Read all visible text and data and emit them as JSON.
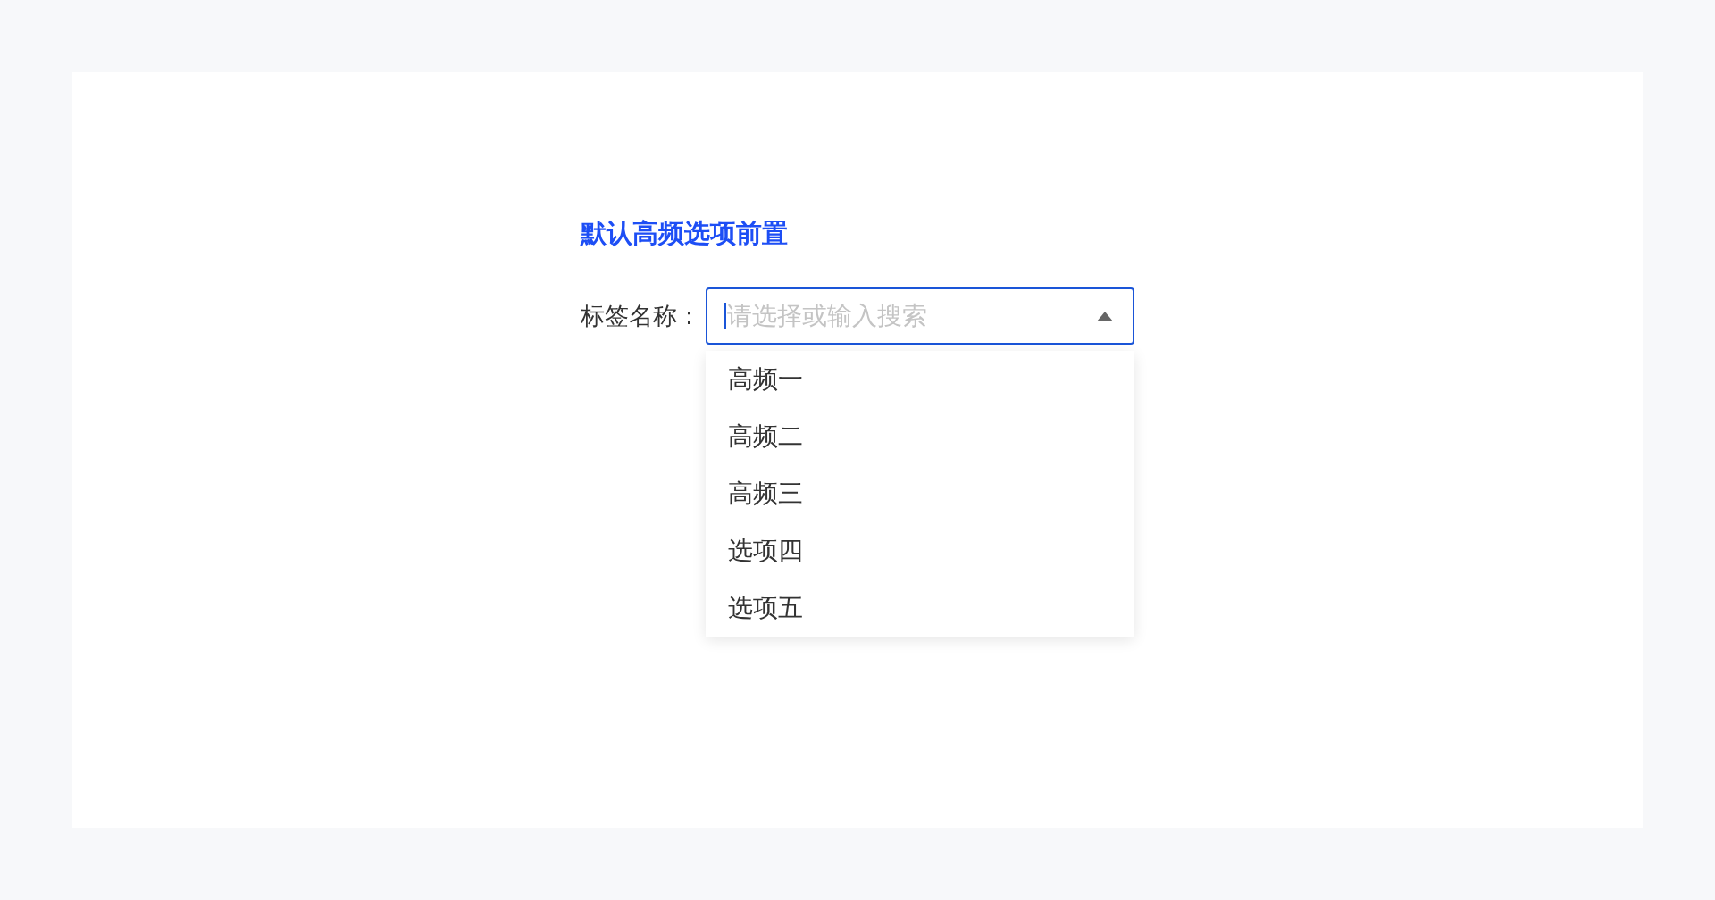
{
  "title": "默认高频选项前置",
  "field": {
    "label": "标签名称：",
    "placeholder": "请选择或输入搜索",
    "focused": true,
    "expanded": true
  },
  "options": [
    {
      "label": "高频一",
      "selected": false
    },
    {
      "label": "高频二",
      "selected": false
    },
    {
      "label": "高频三",
      "selected": false
    },
    {
      "label": "选项四",
      "selected": false
    },
    {
      "label": "选项五",
      "selected": false
    }
  ]
}
